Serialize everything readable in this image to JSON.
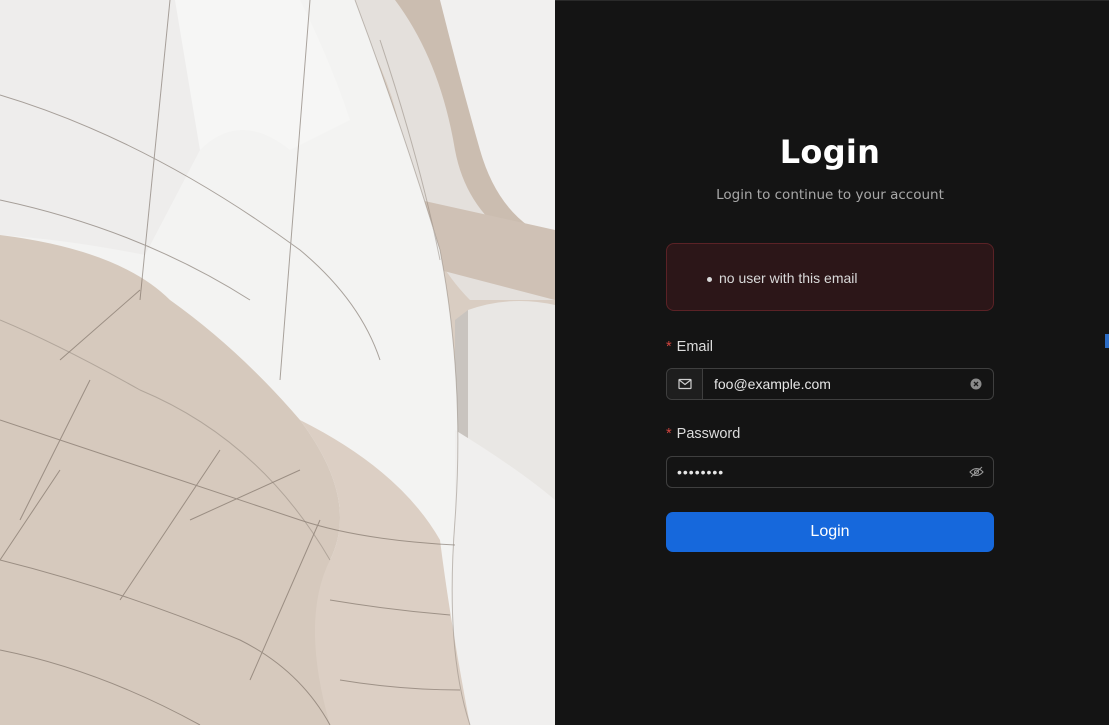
{
  "login": {
    "title": "Login",
    "subtitle": "Login to continue to your account",
    "error_messages": [
      "no user with this email"
    ],
    "email": {
      "label": "Email",
      "required_mark": "*",
      "value": "foo@example.com",
      "prefix_icon": "mail-icon",
      "clear_icon": "clear-circle-icon"
    },
    "password": {
      "label": "Password",
      "required_mark": "*",
      "masked_value": "••••••••",
      "toggle_icon": "eye-invisible-icon"
    },
    "submit_label": "Login"
  },
  "colors": {
    "background": "#141414",
    "primary": "#1668dc",
    "error_bg": "#2c1618",
    "error_border": "#5b2226",
    "required": "#d2453f"
  }
}
